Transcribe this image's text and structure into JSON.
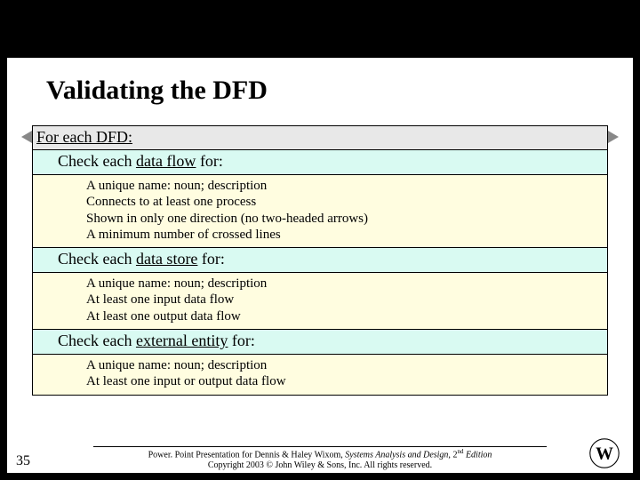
{
  "slide": {
    "title": "Validating the DFD",
    "header": "For each DFD:",
    "sections": [
      {
        "check_prefix": "Check each ",
        "check_term": "data flow",
        "check_suffix": " for:",
        "items": [
          "A unique name: noun; description",
          "Connects to at least one process",
          "Shown in only one direction (no two-headed arrows)",
          "A minimum number of crossed lines"
        ]
      },
      {
        "check_prefix": "Check each ",
        "check_term": "data store",
        "check_suffix": " for:",
        "items": [
          "A unique name: noun; description",
          "At least one input data flow",
          "At least one output data flow"
        ]
      },
      {
        "check_prefix": "Check each ",
        "check_term": "external entity",
        "check_suffix": " for:",
        "items": [
          "A unique name: noun; description",
          "At least one input  or output data flow"
        ]
      }
    ],
    "footer": {
      "line1_a": "Power. Point Presentation for Dennis & Haley Wixom, ",
      "line1_title": "Systems Analysis and Design,",
      "line1_b": " 2",
      "line1_sup": "nd",
      "line1_c": " Edition",
      "line2": "Copyright 2003 © John Wiley & Sons, Inc.  All rights reserved."
    },
    "slide_number": "35"
  }
}
